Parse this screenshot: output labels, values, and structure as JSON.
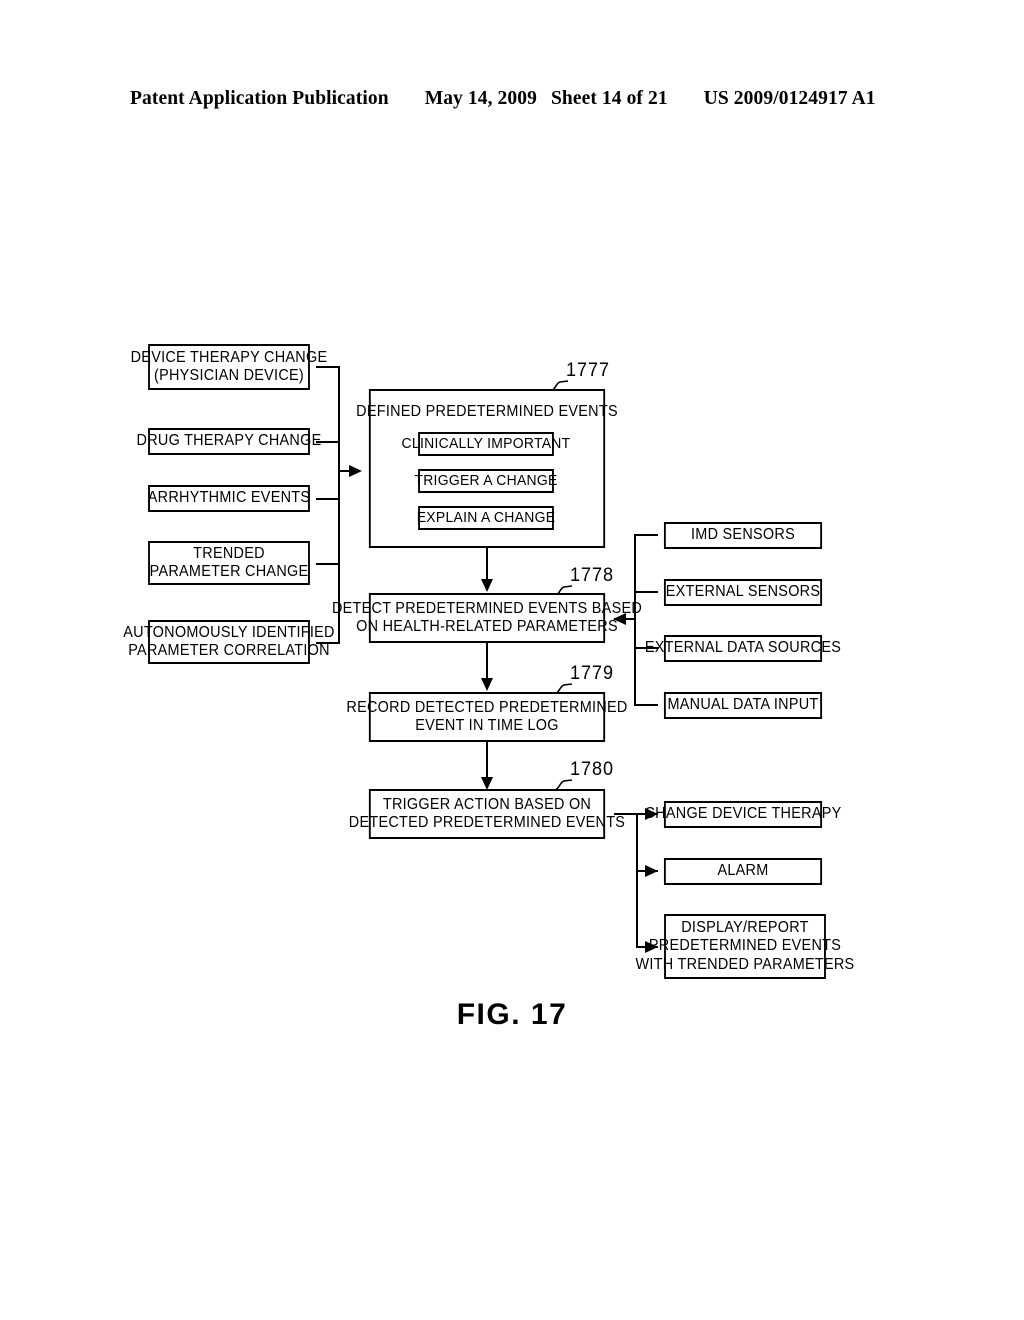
{
  "header": {
    "publication": "Patent Application Publication",
    "date": "May 14, 2009",
    "sheet": "Sheet 14 of 21",
    "patent_number": "US 2009/0124917 A1"
  },
  "figure": {
    "caption": "FIG.  17",
    "title": "Predetermined event detection and trigger flow diagram"
  },
  "inputs": {
    "boxes": [
      {
        "id": "device-therapy-change",
        "lines": [
          "DEVICE THERAPY CHANGE",
          "(PHYSICIAN DEVICE)"
        ]
      },
      {
        "id": "drug-therapy-change",
        "lines": [
          "DRUG THERAPY CHANGE"
        ]
      },
      {
        "id": "arrhythmic-events",
        "lines": [
          "ARRHYTHMIC EVENTS"
        ]
      },
      {
        "id": "trended-parameter-change",
        "lines": [
          "TRENDED",
          "PARAMETER CHANGE"
        ]
      },
      {
        "id": "autonomously-identified-parameter-correlation",
        "lines": [
          "AUTONOMOUSLY IDENTIFIED",
          "PARAMETER CORRELATION"
        ]
      }
    ]
  },
  "process": {
    "defined_events": {
      "ref": "1777",
      "title": "DEFINED PREDETERMINED EVENTS",
      "items": [
        {
          "id": "clinically-important",
          "label": "CLINICALLY IMPORTANT"
        },
        {
          "id": "trigger-a-change",
          "label": "TRIGGER A CHANGE"
        },
        {
          "id": "explain-a-change",
          "label": "EXPLAIN A CHANGE"
        }
      ]
    },
    "detect_events": {
      "ref": "1778",
      "lines": [
        "DETECT PREDETERMINED EVENTS BASED",
        "ON HEALTH-RELATED PARAMETERS"
      ]
    },
    "record_event": {
      "ref": "1779",
      "lines": [
        "RECORD DETECTED PREDETERMINED",
        "EVENT IN TIME LOG"
      ]
    },
    "trigger_action": {
      "ref": "1780",
      "lines": [
        "TRIGGER ACTION BASED ON",
        "DETECTED PREDETERMINED EVENTS"
      ]
    }
  },
  "data_sources": {
    "boxes": [
      {
        "id": "imd-sensors",
        "lines": [
          "IMD SENSORS"
        ]
      },
      {
        "id": "external-sensors",
        "lines": [
          "EXTERNAL SENSORS"
        ]
      },
      {
        "id": "external-data-sources",
        "lines": [
          "EXTERNAL DATA SOURCES"
        ]
      },
      {
        "id": "manual-data-input",
        "lines": [
          "MANUAL DATA INPUT"
        ]
      }
    ]
  },
  "actions": {
    "boxes": [
      {
        "id": "change-device-therapy",
        "lines": [
          "CHANGE DEVICE THERAPY"
        ]
      },
      {
        "id": "alarm",
        "lines": [
          "ALARM"
        ]
      },
      {
        "id": "display-report",
        "lines": [
          "DISPLAY/REPORT",
          "PREDETERMINED EVENTS",
          "WITH TRENDED PARAMETERS"
        ]
      }
    ]
  },
  "colors": {
    "ink": "#000000",
    "paper": "#ffffff"
  }
}
